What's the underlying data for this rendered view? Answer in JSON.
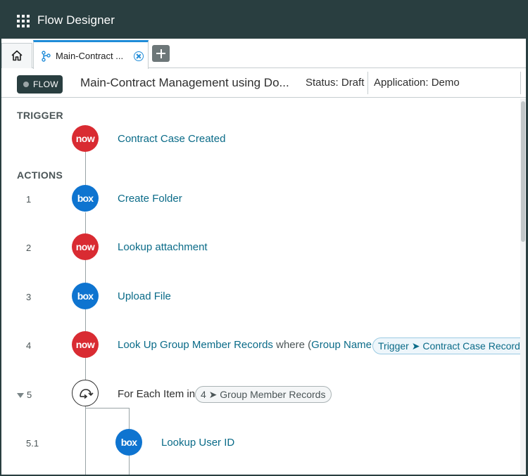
{
  "app": {
    "title": "Flow Designer",
    "menu_icon": "grid-menu-icon"
  },
  "tabs": {
    "home_icon": "home-icon",
    "active": {
      "label": "Main-Contract ...",
      "icon": "flow-branch-icon",
      "close_icon": "close-circle-icon"
    },
    "add_icon": "plus-icon"
  },
  "flowbar": {
    "badge": "FLOW",
    "name": "Main-Contract Management using Do...",
    "status": "Status: Draft",
    "application": "Application:  Demo"
  },
  "canvas": {
    "trigger_label": "TRIGGER",
    "actions_label": "ACTIONS",
    "trigger": {
      "icon_text": "now",
      "title": "Contract Case Created"
    },
    "steps": [
      {
        "num": "1",
        "icon_text": "box",
        "title": "Create Folder"
      },
      {
        "num": "2",
        "icon_text": "now",
        "title": "Lookup attachment"
      },
      {
        "num": "3",
        "icon_text": "box",
        "title": "Upload File"
      },
      {
        "num": "4",
        "icon_text": "now",
        "title": "Look Up Group Member Records",
        "where": "where (",
        "field": "Group Name is",
        "chip": "Trigger ➤ Contract Case Record ➤"
      },
      {
        "num": "5",
        "title": "For Each Item in",
        "chip": "4 ➤ Group Member Records"
      },
      {
        "num": "5.1",
        "icon_text": "box",
        "title": "Lookup User ID"
      }
    ]
  },
  "colors": {
    "servicenow_red": "#d92b32",
    "box_blue": "#0e74d0",
    "link_teal": "#0a6b88",
    "header_dark": "#293e40",
    "active_tab": "#1f8cd8"
  }
}
